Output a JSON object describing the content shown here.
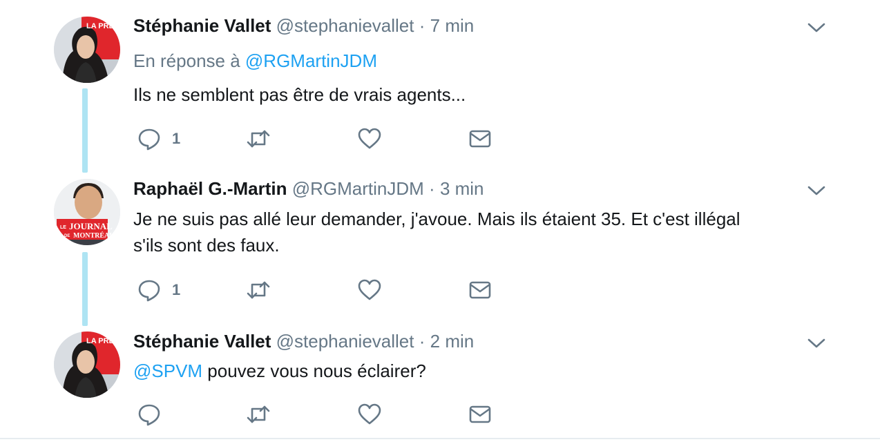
{
  "tweets": [
    {
      "name": "Stéphanie Vallet",
      "handle": "@stephanievallet",
      "separator": "·",
      "time": "7 min",
      "reply_prefix": "En réponse à",
      "reply_mention": "@RGMartinJDM",
      "text": "Ils ne semblent pas être de vrais agents...",
      "reply_count": "1",
      "avatar_brand": "LA PRESSE"
    },
    {
      "name": "Raphaël G.-Martin",
      "handle": "@RGMartinJDM",
      "separator": "·",
      "time": "3 min",
      "text_line1": "Je ne suis pas allé leur demander, j'avoue. Mais ils étaient 35. Et c'est illégal",
      "text_line2": "s'ils sont des faux.",
      "reply_count": "1",
      "avatar_brand_top": "LE",
      "avatar_brand_main": "JOURNAL",
      "avatar_brand_small": "DE",
      "avatar_brand_bottom": "MONTRÉAL"
    },
    {
      "name": "Stéphanie Vallet",
      "handle": "@stephanievallet",
      "separator": "·",
      "time": "2 min",
      "mention": "@SPVM",
      "text": " pouvez vous nous éclairer?",
      "avatar_brand": "LA PRESSE"
    }
  ],
  "icons": {
    "reply": "reply-icon",
    "retweet": "retweet-icon",
    "like": "heart-icon",
    "dm": "envelope-icon",
    "more": "chevron-down-icon"
  },
  "colors": {
    "link": "#1da1f2",
    "muted": "#657786",
    "thread": "#aee4f3",
    "brand_red": "#e0262c"
  }
}
